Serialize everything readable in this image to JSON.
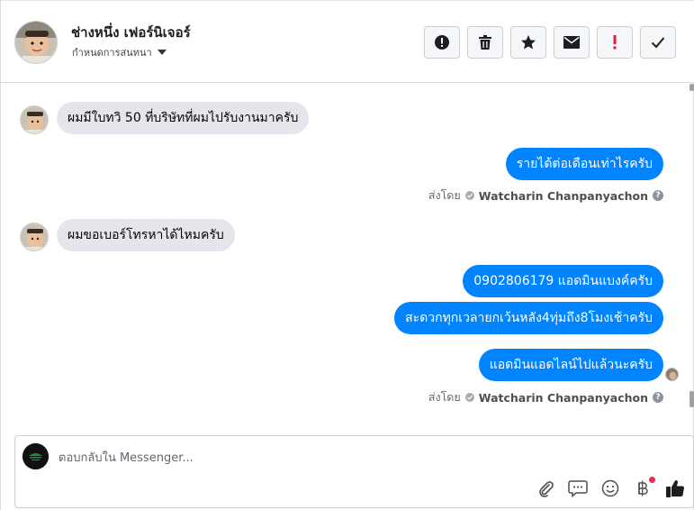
{
  "header": {
    "name": "ช่างหนึ่ง เฟอร์นิเจอร์",
    "subtitle": "กำหนดการสนทนา",
    "actions": [
      {
        "icon": "alert-circle-icon"
      },
      {
        "icon": "trash-icon"
      },
      {
        "icon": "star-icon"
      },
      {
        "icon": "envelope-icon"
      },
      {
        "icon": "exclamation-icon"
      },
      {
        "icon": "check-icon"
      }
    ]
  },
  "thread": {
    "messages": [
      {
        "direction": "in",
        "text": "ผมมีใบทวิ 50 ที่บริษัทที่ผมไปรับงานมาครับ"
      },
      {
        "direction": "out",
        "text": "รายได้ต่อเดือนเท่าไรครับ"
      },
      {
        "direction": "in",
        "text": "ผมขอเบอร์โทรหาได้ไหมครับ"
      },
      {
        "direction": "out",
        "text": "0902806179 แอดมินแบงค์ครับ"
      },
      {
        "direction": "out",
        "text": "สะดวกทุกเวลายกเว้นหลัง4ทุ่มถึง8โมงเช้าครับ"
      },
      {
        "direction": "out",
        "text": "แอดมินแอดไลน์ไปแล้วนะครับ"
      }
    ],
    "sent_by_label": "ส่งโดย",
    "sent_by_name": "Watcharin Chanpanyachon",
    "help_glyph": "?"
  },
  "composer": {
    "placeholder": "ตอบกลับใน Messenger...",
    "tools": [
      {
        "icon": "paperclip-icon"
      },
      {
        "icon": "saved-reply-icon"
      },
      {
        "icon": "emoji-icon"
      },
      {
        "icon": "baht-icon"
      },
      {
        "icon": "thumbs-up-icon"
      }
    ]
  },
  "colors": {
    "outgoing_bubble": "#0084ff",
    "incoming_bubble": "#e4e6eb",
    "notification_dot": "#f02849"
  }
}
